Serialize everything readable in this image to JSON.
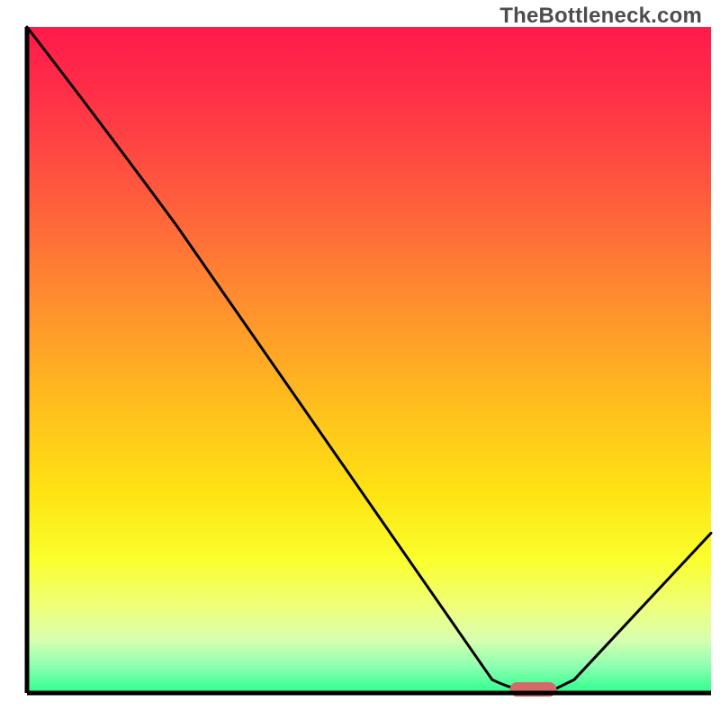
{
  "watermark": "TheBottleneck.com",
  "chart_data": {
    "type": "line",
    "title": "",
    "xlabel": "",
    "ylabel": "",
    "xlim": [
      0,
      100
    ],
    "ylim": [
      0,
      100
    ],
    "series": [
      {
        "name": "bottleneck-curve",
        "x": [
          0,
          12,
          22,
          68,
          72,
          76,
          80,
          100
        ],
        "values": [
          100,
          84,
          70,
          2,
          0,
          0,
          2,
          24
        ]
      }
    ],
    "marker": {
      "name": "optimal-point",
      "x": 74,
      "value": 0,
      "color": "#d66a6a"
    },
    "gradient_stops": [
      {
        "offset": 0.0,
        "color": "#ff1a4b"
      },
      {
        "offset": 0.1,
        "color": "#ff2f48"
      },
      {
        "offset": 0.25,
        "color": "#ff5a3e"
      },
      {
        "offset": 0.4,
        "color": "#ff8a30"
      },
      {
        "offset": 0.55,
        "color": "#ffb91f"
      },
      {
        "offset": 0.7,
        "color": "#ffe313"
      },
      {
        "offset": 0.8,
        "color": "#faff2d"
      },
      {
        "offset": 0.87,
        "color": "#efff7a"
      },
      {
        "offset": 0.92,
        "color": "#d8ffb0"
      },
      {
        "offset": 0.96,
        "color": "#8dffb0"
      },
      {
        "offset": 1.0,
        "color": "#2bff8e"
      }
    ],
    "axis_color": "#000000",
    "curve_color": "#000000",
    "curve_width": 3
  }
}
